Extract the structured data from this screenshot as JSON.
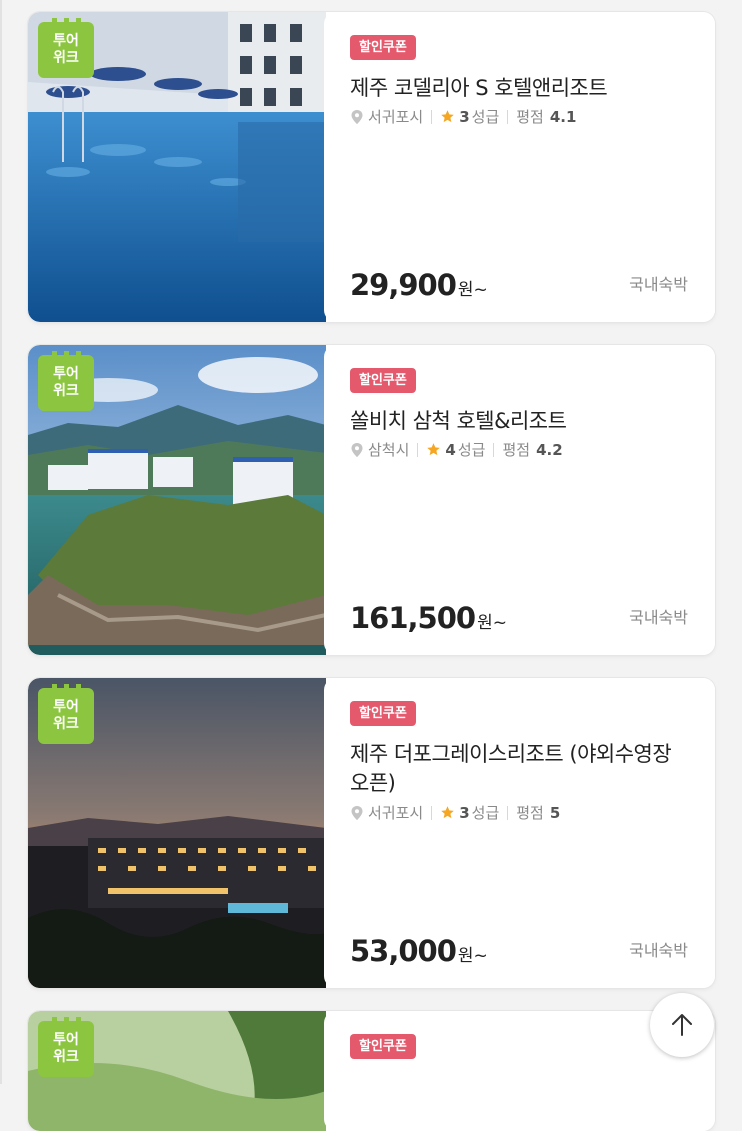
{
  "badge": {
    "line1": "투어",
    "line2": "위크",
    "color": "#8cc640"
  },
  "colors": {
    "coupon": "#e5596d",
    "star": "#f5a623",
    "pin": "#b5b5b5"
  },
  "icons": {
    "location": "map-pin-icon",
    "rating": "star-icon",
    "scroll_top": "arrow-up-icon"
  },
  "listings": [
    {
      "coupon": "할인쿠폰",
      "title": "제주 코델리아 S 호텔앤리조트",
      "location": "서귀포시",
      "grade_num": "3",
      "grade_unit": "성급",
      "score_label": "평점",
      "score": "4.1",
      "price": "29,900",
      "price_unit": "원~",
      "category": "국내숙박"
    },
    {
      "coupon": "할인쿠폰",
      "title": "쏠비치 삼척 호텔&리조트",
      "location": "삼척시",
      "grade_num": "4",
      "grade_unit": "성급",
      "score_label": "평점",
      "score": "4.2",
      "price": "161,500",
      "price_unit": "원~",
      "category": "국내숙박"
    },
    {
      "coupon": "할인쿠폰",
      "title": "제주 더포그레이스리조트 (야외수영장 오픈)",
      "location": "서귀포시",
      "grade_num": "3",
      "grade_unit": "성급",
      "score_label": "평점",
      "score": "5",
      "price": "53,000",
      "price_unit": "원~",
      "category": "국내숙박"
    },
    {
      "coupon": "할인쿠폰"
    }
  ]
}
